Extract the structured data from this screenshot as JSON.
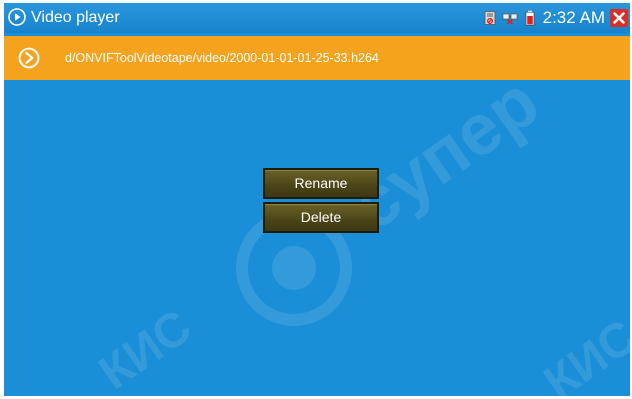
{
  "window": {
    "title": "Video player"
  },
  "status_bar": {
    "time": "2:32 AM",
    "icons": [
      "sd-card-icon",
      "network-icon",
      "battery-icon"
    ],
    "close_icon": "close-icon"
  },
  "path_bar": {
    "icon": "play-arrow-icon",
    "path": "d/ONVIFToolVideotape/video/2000-01-01-01-25-33.h264"
  },
  "context_menu": {
    "rename_label": "Rename",
    "delete_label": "Delete"
  },
  "colors": {
    "background": "#1a8ed6",
    "path_bar": "#f5a21c",
    "menu_button": "#4a4418",
    "close_button": "#d93025"
  }
}
